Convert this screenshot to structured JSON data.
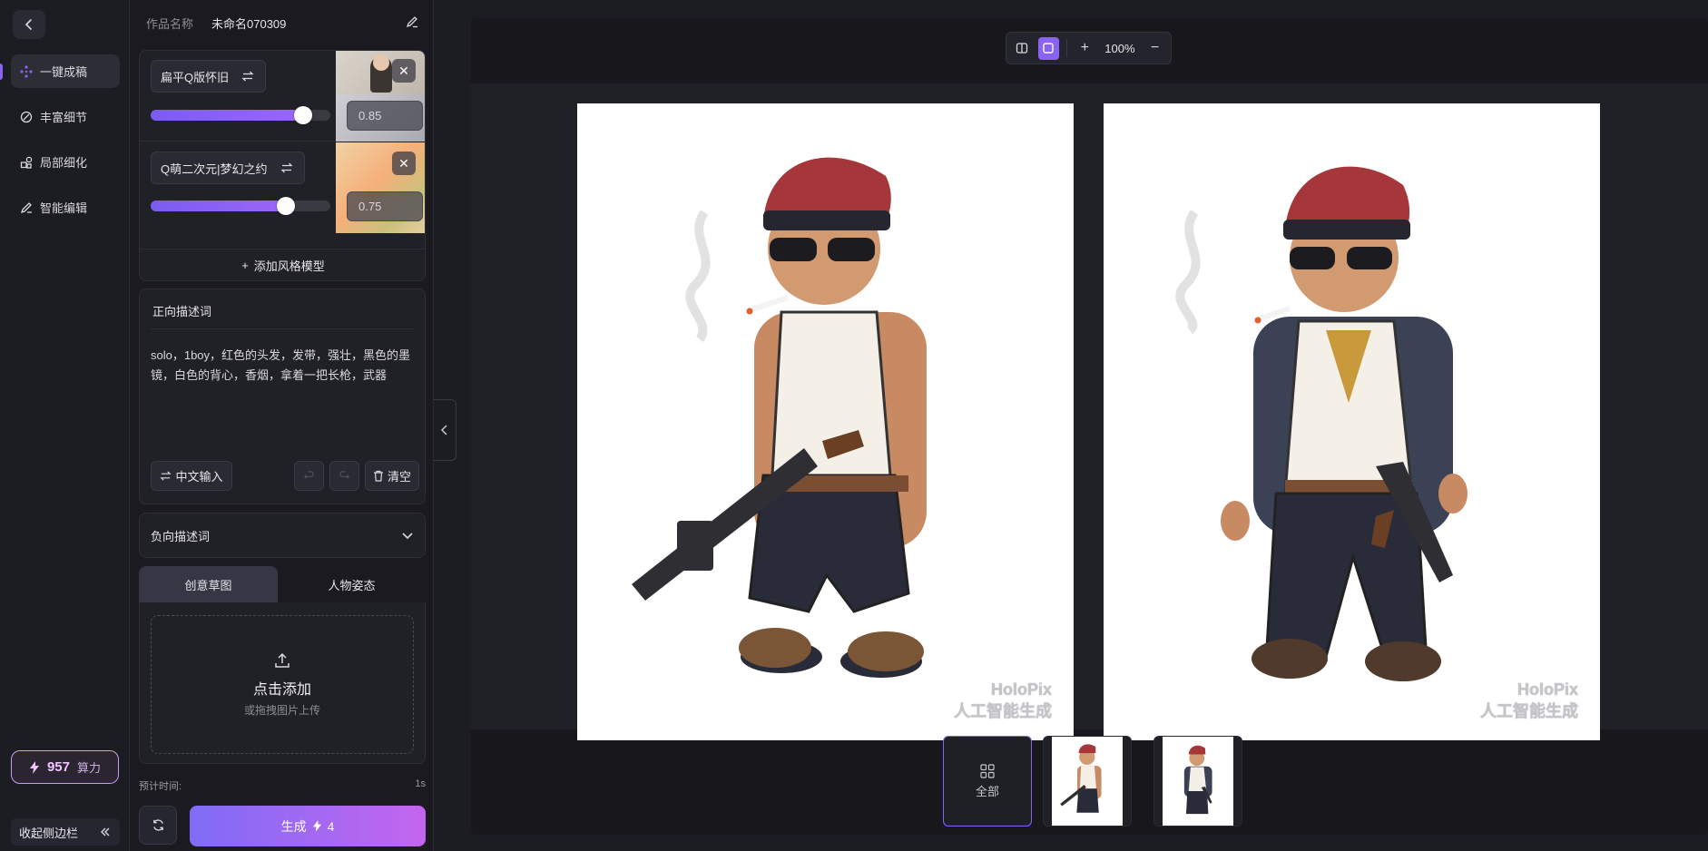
{
  "sidebar": {
    "back_icon": "chevron-left-icon",
    "items": [
      {
        "label": "一键成稿",
        "icon": "sparkle-icon",
        "active": true
      },
      {
        "label": "丰富细节",
        "icon": "palette-icon",
        "active": false
      },
      {
        "label": "局部细化",
        "icon": "shapes-icon",
        "active": false
      },
      {
        "label": "智能编辑",
        "icon": "pen-icon",
        "active": false
      }
    ],
    "credits": {
      "value": "957",
      "unit": "算力"
    },
    "collapse_label": "收起侧边栏"
  },
  "work": {
    "name_label": "作品名称",
    "name_value": "未命名070309"
  },
  "style_models": {
    "items": [
      {
        "name": "扁平Q版怀旧",
        "weight": 0.85,
        "value_text": "0.85"
      },
      {
        "name": "Q萌二次元|梦幻之约",
        "weight": 0.75,
        "value_text": "0.75"
      }
    ],
    "add_label": "添加风格模型"
  },
  "positive_prompt": {
    "header": "正向描述词",
    "text": "solo，1boy，红色的头发，发带，强壮，黑色的墨镜，白色的背心，香烟，拿着一把长枪，武器",
    "chinese_input_label": "中文输入",
    "clear_label": "清空"
  },
  "negative_prompt": {
    "header": "负向描述词"
  },
  "tabs": [
    {
      "label": "创意草图",
      "active": true
    },
    {
      "label": "人物姿态",
      "active": false
    }
  ],
  "upload": {
    "title": "点击添加",
    "subtitle": "或拖拽图片上传"
  },
  "estimate": {
    "label": "预计时间:",
    "value": "1s"
  },
  "generate": {
    "label": "生成",
    "cost": "4"
  },
  "viewer": {
    "zoom": "100%",
    "watermark_line1": "HoloPix",
    "watermark_line2": "人工智能生成",
    "filmstrip_all_label": "全部"
  },
  "colors": {
    "accent": "#8a63f5",
    "generate_start": "#7f6cf6",
    "generate_end": "#c465ee",
    "credits_border": "#c79bff"
  }
}
